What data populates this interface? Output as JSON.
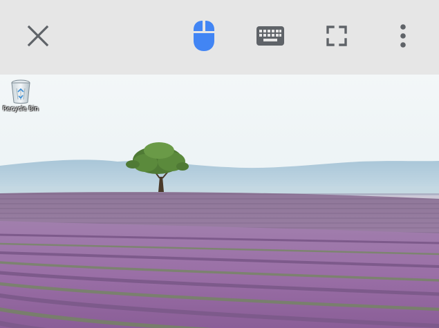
{
  "toolbar": {
    "close": {
      "icon": "close-icon",
      "color": "#5f6368"
    },
    "mouse": {
      "icon": "mouse-icon",
      "color": "#4285f4",
      "active": true
    },
    "keyboard": {
      "icon": "keyboard-icon",
      "color": "#5f6368"
    },
    "fullscreen": {
      "icon": "fullscreen-icon",
      "color": "#5f6368"
    },
    "more": {
      "icon": "more-vertical-icon",
      "color": "#5f6368"
    },
    "background": "#e6e6e6"
  },
  "desktop": {
    "icons": [
      {
        "label": "Recycle Bin",
        "icon": "recycle-bin-icon"
      }
    ],
    "wallpaper": "lavender-field-with-tree"
  }
}
